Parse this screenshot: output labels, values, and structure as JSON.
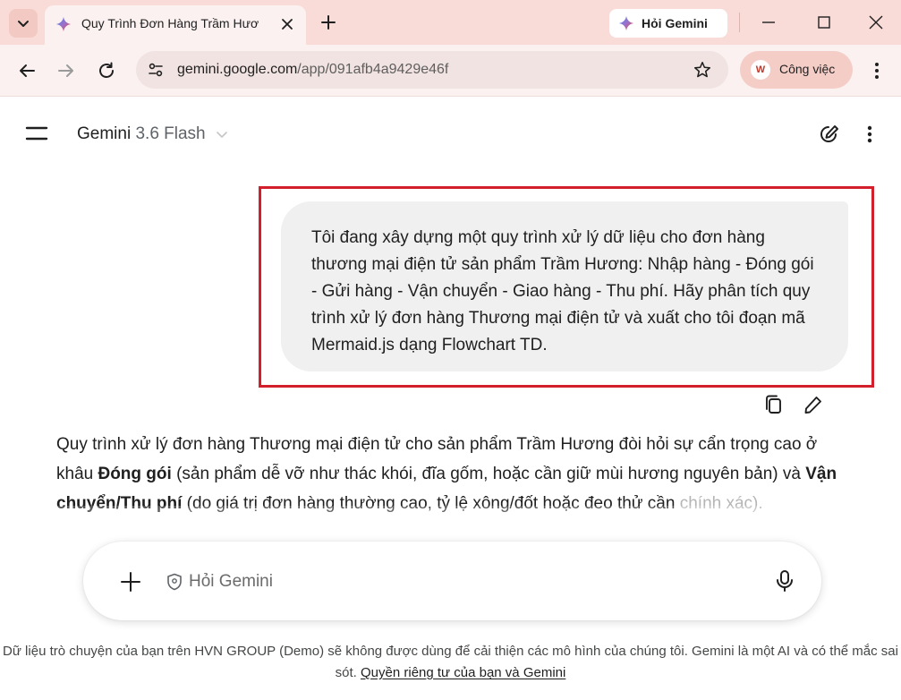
{
  "browser": {
    "tab": {
      "title": "Quy Trình Đơn Hàng Trầm Hươ",
      "favicon": "gemini-sparkle-icon"
    },
    "ask_gemini_label": "Hỏi Gemini",
    "url": {
      "host": "gemini.google.com",
      "path": "/app/091afb4a9429e46f"
    },
    "profile_label": "Công việc"
  },
  "header": {
    "app_name": "Gemini",
    "model": "3.6 Flash"
  },
  "user_prompt": "Tôi đang xây dựng một quy trình xử lý dữ liệu cho đơn hàng thương mại điện tử sản phẩm Trầm Hương: Nhập hàng - Đóng gói - Gửi hàng - Vận chuyển - Giao hàng - Thu phí. Hãy phân tích quy trình xử lý đơn hàng Thương mại điện tử và xuất cho tôi đoạn mã Mermaid.js dạng Flowchart TD.",
  "response": {
    "part1": "Quy trình xử lý đơn hàng Thương mại điện tử cho sản phẩm Trầm Hương đòi hỏi sự cẩn trọng cao ở khâu ",
    "bold1": "Đóng gói",
    "part2": " (sản phẩm dễ vỡ như thác khói, đĩa gốm, hoặc cần giữ mùi hương nguyên bản) và ",
    "bold2": "Vận chuyển/Thu phí",
    "part3": " (do giá trị đơn hàng thường cao, tỷ lệ xông/đốt hoặc đeo thử cần ",
    "part4_faded": "chính xác)."
  },
  "input": {
    "placeholder": "Hỏi Gemini"
  },
  "footer": {
    "text": "Dữ liệu trò chuyện của bạn trên HVN GROUP (Demo) sẽ không được dùng để cải thiện các mô hình của chúng tôi. Gemini là một AI và có thể mắc sai sót. ",
    "link": "Quyền riêng tư của bạn và Gemini"
  },
  "colors": {
    "tabstrip": "#f9dcd8",
    "toolbar": "#fbf1f0",
    "highlight_border": "#d21f2b",
    "bubble": "#f0f0f0"
  }
}
